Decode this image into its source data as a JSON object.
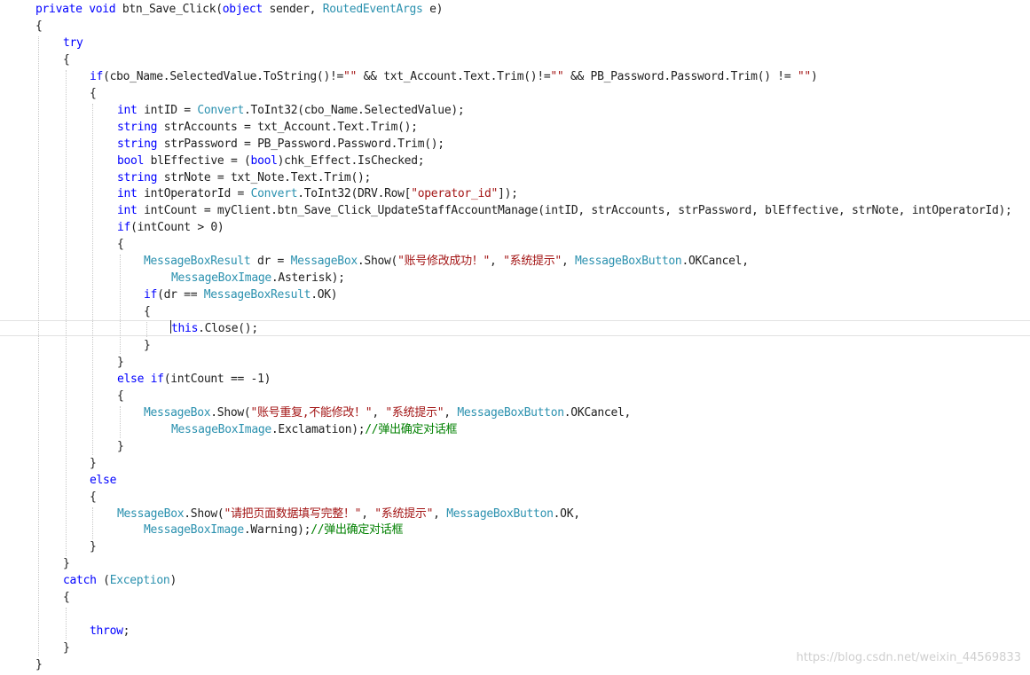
{
  "colors": {
    "keyword": "#0000ff",
    "type": "#2b91af",
    "string": "#a31515",
    "comment": "#008000",
    "plain": "#1e1e1e",
    "watermark": "#cfcfcf"
  },
  "editor": {
    "current_line_number": 20,
    "lines": [
      {
        "indent": 0,
        "tokens": [
          {
            "t": "private",
            "k": "kw"
          },
          {
            "t": " "
          },
          {
            "t": "void",
            "k": "kw"
          },
          {
            "t": " btn_Save_Click("
          },
          {
            "t": "object",
            "k": "kw"
          },
          {
            "t": " sender, "
          },
          {
            "t": "RoutedEventArgs",
            "k": "type"
          },
          {
            "t": " e)"
          }
        ]
      },
      {
        "indent": 0,
        "tokens": [
          {
            "t": "{"
          }
        ]
      },
      {
        "indent": 1,
        "tokens": [
          {
            "t": "try",
            "k": "kw"
          }
        ]
      },
      {
        "indent": 1,
        "tokens": [
          {
            "t": "{"
          }
        ]
      },
      {
        "indent": 2,
        "tokens": [
          {
            "t": "if",
            "k": "kw"
          },
          {
            "t": "(cbo_Name.SelectedValue.ToString()!="
          },
          {
            "t": "\"\"",
            "k": "str"
          },
          {
            "t": " && txt_Account.Text.Trim()!="
          },
          {
            "t": "\"\"",
            "k": "str"
          },
          {
            "t": " && PB_Password.Password.Trim() != "
          },
          {
            "t": "\"\"",
            "k": "str"
          },
          {
            "t": ")"
          }
        ]
      },
      {
        "indent": 2,
        "tokens": [
          {
            "t": "{"
          }
        ]
      },
      {
        "indent": 3,
        "tokens": [
          {
            "t": "int",
            "k": "kw"
          },
          {
            "t": " intID = "
          },
          {
            "t": "Convert",
            "k": "type"
          },
          {
            "t": ".ToInt32(cbo_Name.SelectedValue);"
          }
        ]
      },
      {
        "indent": 3,
        "tokens": [
          {
            "t": "string",
            "k": "kw"
          },
          {
            "t": " strAccounts = txt_Account.Text.Trim();"
          }
        ]
      },
      {
        "indent": 3,
        "tokens": [
          {
            "t": "string",
            "k": "kw"
          },
          {
            "t": " strPassword = PB_Password.Password.Trim();"
          }
        ]
      },
      {
        "indent": 3,
        "tokens": [
          {
            "t": "bool",
            "k": "kw"
          },
          {
            "t": " blEffective = ("
          },
          {
            "t": "bool",
            "k": "kw"
          },
          {
            "t": ")chk_Effect.IsChecked;"
          }
        ]
      },
      {
        "indent": 3,
        "tokens": [
          {
            "t": "string",
            "k": "kw"
          },
          {
            "t": " strNote = txt_Note.Text.Trim();"
          }
        ]
      },
      {
        "indent": 3,
        "tokens": [
          {
            "t": "int",
            "k": "kw"
          },
          {
            "t": " intOperatorId = "
          },
          {
            "t": "Convert",
            "k": "type"
          },
          {
            "t": ".ToInt32(DRV.Row["
          },
          {
            "t": "\"operator_id\"",
            "k": "str"
          },
          {
            "t": "]);"
          }
        ]
      },
      {
        "indent": 3,
        "tokens": [
          {
            "t": "int",
            "k": "kw"
          },
          {
            "t": " intCount = myClient.btn_Save_Click_UpdateStaffAccountManage(intID, strAccounts, strPassword, blEffective, strNote, intOperatorId);"
          }
        ]
      },
      {
        "indent": 3,
        "tokens": [
          {
            "t": "if",
            "k": "kw"
          },
          {
            "t": "(intCount > 0)"
          }
        ]
      },
      {
        "indent": 3,
        "tokens": [
          {
            "t": "{"
          }
        ]
      },
      {
        "indent": 4,
        "tokens": [
          {
            "t": "MessageBoxResult",
            "k": "type"
          },
          {
            "t": " dr = "
          },
          {
            "t": "MessageBox",
            "k": "type"
          },
          {
            "t": ".Show("
          },
          {
            "t": "\"账号修改成功！\"",
            "k": "str"
          },
          {
            "t": ", "
          },
          {
            "t": "\"系统提示\"",
            "k": "str"
          },
          {
            "t": ", "
          },
          {
            "t": "MessageBoxButton",
            "k": "type"
          },
          {
            "t": ".OKCancel,"
          }
        ]
      },
      {
        "indent": 5,
        "tokens": [
          {
            "t": "MessageBoxImage",
            "k": "type"
          },
          {
            "t": ".Asterisk);"
          }
        ]
      },
      {
        "indent": 4,
        "tokens": [
          {
            "t": "if",
            "k": "kw"
          },
          {
            "t": "(dr == "
          },
          {
            "t": "MessageBoxResult",
            "k": "type"
          },
          {
            "t": ".OK)"
          }
        ]
      },
      {
        "indent": 4,
        "tokens": [
          {
            "t": "{"
          }
        ]
      },
      {
        "indent": 5,
        "tokens": [
          {
            "t": "this",
            "k": "kw"
          },
          {
            "t": ".Close();"
          }
        ]
      },
      {
        "indent": 4,
        "tokens": [
          {
            "t": "}"
          }
        ]
      },
      {
        "indent": 3,
        "tokens": [
          {
            "t": "}"
          }
        ]
      },
      {
        "indent": 3,
        "tokens": [
          {
            "t": "else",
            "k": "kw"
          },
          {
            "t": " "
          },
          {
            "t": "if",
            "k": "kw"
          },
          {
            "t": "(intCount == -1)"
          }
        ]
      },
      {
        "indent": 3,
        "tokens": [
          {
            "t": "{"
          }
        ]
      },
      {
        "indent": 4,
        "tokens": [
          {
            "t": "MessageBox",
            "k": "type"
          },
          {
            "t": ".Show("
          },
          {
            "t": "\"账号重复,不能修改！\"",
            "k": "str"
          },
          {
            "t": ", "
          },
          {
            "t": "\"系统提示\"",
            "k": "str"
          },
          {
            "t": ", "
          },
          {
            "t": "MessageBoxButton",
            "k": "type"
          },
          {
            "t": ".OKCancel,"
          }
        ]
      },
      {
        "indent": 5,
        "tokens": [
          {
            "t": "MessageBoxImage",
            "k": "type"
          },
          {
            "t": ".Exclamation);"
          },
          {
            "t": "//弹出确定对话框",
            "k": "cm"
          }
        ]
      },
      {
        "indent": 3,
        "tokens": [
          {
            "t": "}"
          }
        ]
      },
      {
        "indent": 2,
        "tokens": [
          {
            "t": "}"
          }
        ]
      },
      {
        "indent": 2,
        "tokens": [
          {
            "t": "else",
            "k": "kw"
          }
        ]
      },
      {
        "indent": 2,
        "tokens": [
          {
            "t": "{"
          }
        ]
      },
      {
        "indent": 3,
        "tokens": [
          {
            "t": "MessageBox",
            "k": "type"
          },
          {
            "t": ".Show("
          },
          {
            "t": "\"请把页面数据填写完整！\"",
            "k": "str"
          },
          {
            "t": ", "
          },
          {
            "t": "\"系统提示\"",
            "k": "str"
          },
          {
            "t": ", "
          },
          {
            "t": "MessageBoxButton",
            "k": "type"
          },
          {
            "t": ".OK,"
          }
        ]
      },
      {
        "indent": 4,
        "tokens": [
          {
            "t": "MessageBoxImage",
            "k": "type"
          },
          {
            "t": ".Warning);"
          },
          {
            "t": "//弹出确定对话框",
            "k": "cm"
          }
        ]
      },
      {
        "indent": 2,
        "tokens": [
          {
            "t": "}"
          }
        ]
      },
      {
        "indent": 1,
        "tokens": [
          {
            "t": "}"
          }
        ]
      },
      {
        "indent": 1,
        "tokens": [
          {
            "t": "catch",
            "k": "kw"
          },
          {
            "t": " ("
          },
          {
            "t": "Exception",
            "k": "type"
          },
          {
            "t": ")"
          }
        ]
      },
      {
        "indent": 1,
        "tokens": [
          {
            "t": "{"
          }
        ]
      },
      {
        "indent": 0,
        "tokens": []
      },
      {
        "indent": 2,
        "tokens": [
          {
            "t": "throw",
            "k": "kw"
          },
          {
            "t": ";"
          }
        ]
      },
      {
        "indent": 1,
        "tokens": [
          {
            "t": "}"
          }
        ]
      },
      {
        "indent": 0,
        "tokens": [
          {
            "t": "}"
          }
        ]
      }
    ]
  },
  "watermark": "https://blog.csdn.net/weixin_44569833"
}
